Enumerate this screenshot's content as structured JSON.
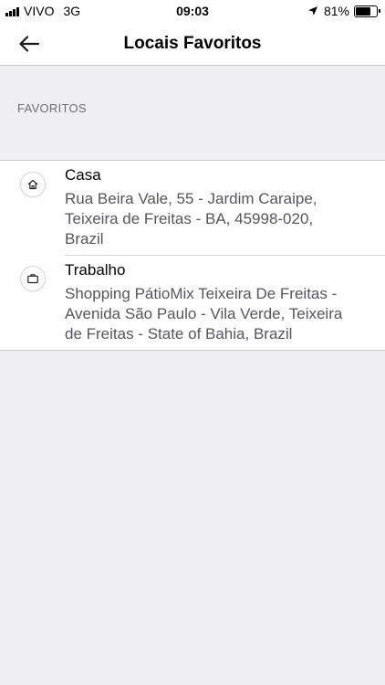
{
  "status_bar": {
    "carrier": "VIVO",
    "network": "3G",
    "time": "09:03",
    "battery_text": "81%",
    "battery_level": 0.81,
    "icons": [
      "signal-icon",
      "location-arrow-icon",
      "battery-icon"
    ]
  },
  "nav": {
    "title": "Locais Favoritos",
    "back_icon": "back-arrow-icon"
  },
  "section": {
    "header": "FAVORITOS"
  },
  "favorites": [
    {
      "title": "Casa",
      "icon": "home-icon",
      "address_lines": [
        "Rua Beira Vale, 55 - Jardim Caraipe,",
        "Teixeira de Freitas - BA, 45998-020,",
        "Brazil"
      ]
    },
    {
      "title": "Trabalho",
      "icon": "briefcase-icon",
      "address_lines": [
        "Shopping PátioMix Teixeira De Freitas -",
        "Avenida São Paulo - Vila Verde, Teixeira",
        "de Freitas - State of Bahia, Brazil"
      ]
    }
  ],
  "colors": {
    "background": "#efeff4",
    "surface": "#ffffff",
    "secondary_text": "#56565c",
    "section_header": "#6d6d72",
    "separator": "#c8c7cc"
  }
}
